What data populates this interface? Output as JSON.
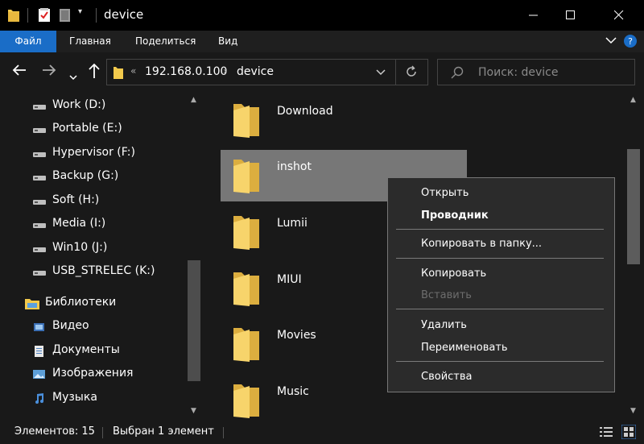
{
  "window": {
    "title": "device"
  },
  "ribbon": {
    "tabs": [
      "Файл",
      "Главная",
      "Поделиться",
      "Вид"
    ]
  },
  "address": {
    "crumbs": [
      "192.168.0.100",
      "device"
    ],
    "overflow": "«"
  },
  "search": {
    "placeholder": "Поиск: device"
  },
  "nav": {
    "drives": [
      {
        "label": "Work (D:)",
        "icon": "drive-icon"
      },
      {
        "label": "Portable (E:)",
        "icon": "drive-icon"
      },
      {
        "label": "Hypervisor (F:)",
        "icon": "drive-icon"
      },
      {
        "label": "Backup (G:)",
        "icon": "drive-icon"
      },
      {
        "label": "Soft (H:)",
        "icon": "drive-icon"
      },
      {
        "label": "Media (I:)",
        "icon": "drive-icon"
      },
      {
        "label": "Win10 (J:)",
        "icon": "drive-icon"
      },
      {
        "label": "USB_STRELEC (K:)",
        "icon": "drive-icon"
      }
    ],
    "libraries": {
      "label": "Библиотеки",
      "icon": "libraries-icon"
    },
    "lib_items": [
      {
        "label": "Видео",
        "icon": "video-icon"
      },
      {
        "label": "Документы",
        "icon": "documents-icon"
      },
      {
        "label": "Изображения",
        "icon": "pictures-icon"
      },
      {
        "label": "Музыка",
        "icon": "music-icon"
      }
    ]
  },
  "files": [
    {
      "name": "Download",
      "selected": false
    },
    {
      "name": "inshot",
      "selected": true
    },
    {
      "name": "Lumii",
      "selected": false
    },
    {
      "name": "MIUI",
      "selected": false
    },
    {
      "name": "Movies",
      "selected": false
    },
    {
      "name": "Music",
      "selected": false
    }
  ],
  "context_menu": {
    "open": "Открыть",
    "explorer": "Проводник",
    "copy_to": "Копировать в папку...",
    "copy": "Копировать",
    "paste": "Вставить",
    "delete": "Удалить",
    "rename": "Переименовать",
    "properties": "Свойства"
  },
  "status": {
    "count": "Элементов: 15",
    "selected": "Выбран 1 элемент"
  },
  "colors": {
    "accent": "#1a6dc7",
    "folder": "#f2c94c",
    "selection": "#777777"
  }
}
